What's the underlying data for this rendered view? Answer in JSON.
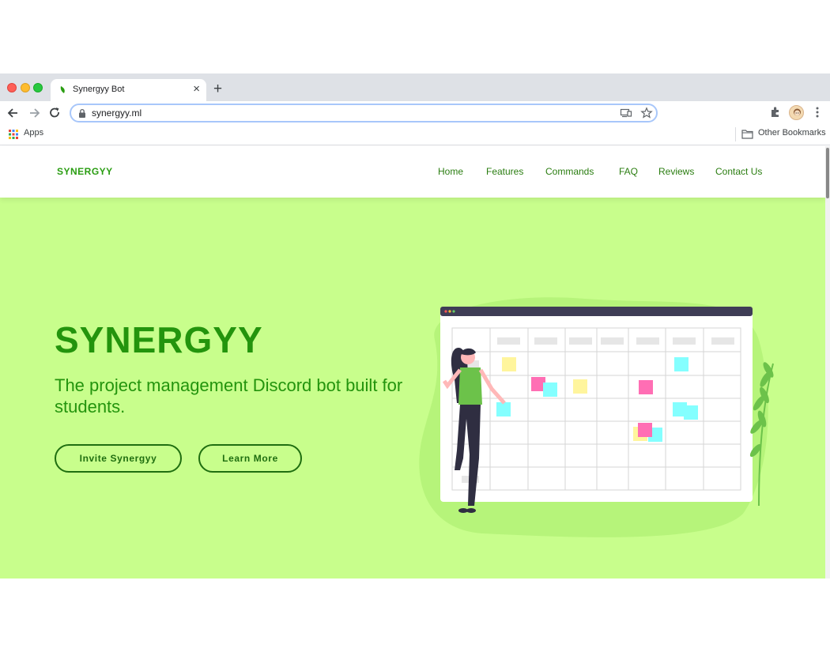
{
  "browser": {
    "tab_title": "Synergyy Bot",
    "tab_close": "×",
    "new_tab": "+",
    "url": "synergyy.ml",
    "bookmarks": {
      "apps_label": "Apps",
      "other_label": "Other Bookmarks"
    }
  },
  "header": {
    "logo": "SYNERGYY",
    "nav": [
      "Home",
      "Features",
      "Commands",
      "FAQ",
      "Reviews",
      "Contact Us"
    ]
  },
  "hero": {
    "title": "SYNERGYY",
    "subtitle": "The project management Discord bot built for students.",
    "buttons": {
      "invite": "Invite Synergyy",
      "learn": "Learn More"
    }
  },
  "colors": {
    "hero_bg": "#c8fe8c",
    "brand_green": "#23940d",
    "nav_green": "#2a7d10"
  },
  "icons": [
    "back-icon",
    "forward-icon",
    "reload-icon",
    "lock-icon",
    "cast-icon",
    "star-icon",
    "extensions-icon",
    "menu-icon",
    "apps-icon",
    "folder-icon"
  ]
}
